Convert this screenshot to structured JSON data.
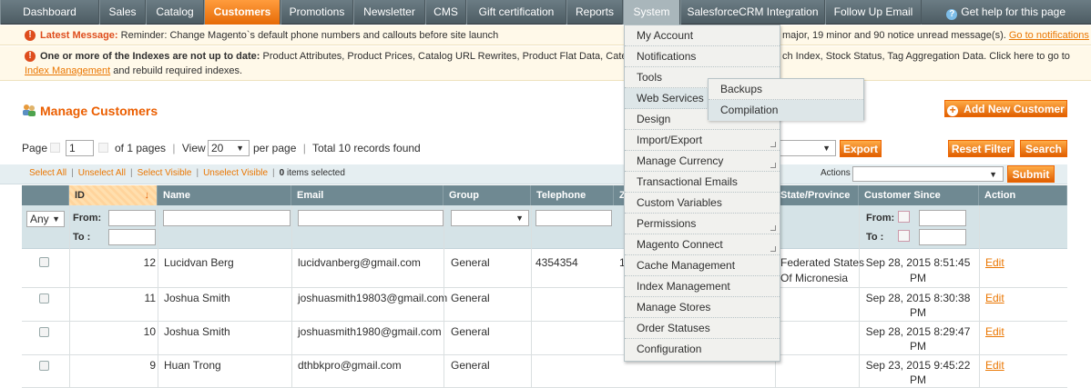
{
  "nav": {
    "items": [
      {
        "label": "Dashboard"
      },
      {
        "label": "Sales"
      },
      {
        "label": "Catalog"
      },
      {
        "label": "Customers"
      },
      {
        "label": "Promotions"
      },
      {
        "label": "Newsletter"
      },
      {
        "label": "CMS"
      },
      {
        "label": "Gift certification"
      },
      {
        "label": "Reports"
      },
      {
        "label": "System"
      },
      {
        "label": "SalesforceCRM Integration"
      },
      {
        "label": "Follow Up Email"
      }
    ],
    "active": "Customers",
    "open": "System",
    "help": "Get help for this page"
  },
  "messages": {
    "latest_label": "Latest Message:",
    "latest_text": "Reminder: Change Magento`s default phone numbers and callouts before site launch",
    "notice_counts_text": "major, 19 minor and 90 notice unread message(s).",
    "notice_link": "Go to notifications",
    "index_label": "One or more of the Indexes are not up to date:",
    "index_text_a": "Product Attributes, Product Prices, Catalog URL Rewrites, Product Flat Data, Category Flat D",
    "index_text_b": "ch Index, Stock Status, Tag Aggregation Data. Click here to go to",
    "index_link": "Index Management",
    "index_text_c": "and rebuild required indexes."
  },
  "header": {
    "title": "Manage Customers",
    "add_button": "Add New Customer"
  },
  "pager": {
    "page_label": "Page",
    "page_value": "1",
    "of_pages": "of 1 pages",
    "view_label": "View",
    "per_page_value": "20",
    "per_page_label": "per page",
    "total": "Total 10 records found",
    "export_button": "Export",
    "reset_button": "Reset Filter",
    "search_button": "Search"
  },
  "massaction": {
    "select_all": "Select All",
    "unselect_all": "Unselect All",
    "select_visible": "Select Visible",
    "unselect_visible": "Unselect Visible",
    "selected_count": "0",
    "selected_label": "items selected",
    "actions_label": "Actions",
    "submit_button": "Submit"
  },
  "grid": {
    "columns": {
      "id": "ID",
      "name": "Name",
      "email": "Email",
      "group": "Group",
      "telephone": "Telephone",
      "zip": "Z",
      "state": "State/Province",
      "since": "Customer Since",
      "action": "Action"
    },
    "filter": {
      "any": "Any",
      "from": "From:",
      "to": "To :"
    },
    "rows": [
      {
        "id": "12",
        "name": "Lucidvan Berg",
        "email": "lucidvanberg@gmail.com",
        "group": "General",
        "telephone": "4354354",
        "zip": "1",
        "state_1": "Federated States",
        "state_2": "Of Micronesia",
        "since_1": "Sep 28, 2015 8:51:45",
        "since_2": "PM",
        "action": "Edit"
      },
      {
        "id": "11",
        "name": "Joshua Smith",
        "email": "joshuasmith19803@gmail.com",
        "group": "General",
        "telephone": "",
        "zip": "",
        "state_1": "",
        "state_2": "",
        "since_1": "Sep 28, 2015 8:30:38",
        "since_2": "PM",
        "action": "Edit"
      },
      {
        "id": "10",
        "name": "Joshua Smith",
        "email": "joshuasmith1980@gmail.com",
        "group": "General",
        "telephone": "",
        "zip": "",
        "state_1": "",
        "state_2": "",
        "since_1": "Sep 28, 2015 8:29:47",
        "since_2": "PM",
        "action": "Edit"
      },
      {
        "id": "9",
        "name": "Huan Trong",
        "email": "dthbkpro@gmail.com",
        "group": "General",
        "telephone": "",
        "zip": "",
        "state_1": "",
        "state_2": "",
        "since_1": "Sep 23, 2015 9:45:22",
        "since_2": "PM",
        "action": "Edit"
      }
    ]
  },
  "system_menu": {
    "items": [
      {
        "label": "My Account"
      },
      {
        "label": "Notifications"
      },
      {
        "label": "Tools"
      },
      {
        "label": "Web Services"
      },
      {
        "label": "Design"
      },
      {
        "label": "Import/Export"
      },
      {
        "label": "Manage Currency"
      },
      {
        "label": "Transactional Emails"
      },
      {
        "label": "Custom Variables"
      },
      {
        "label": "Permissions"
      },
      {
        "label": "Magento Connect"
      },
      {
        "label": "Cache Management"
      },
      {
        "label": "Index Management"
      },
      {
        "label": "Manage Stores"
      },
      {
        "label": "Order Statuses"
      },
      {
        "label": "Configuration"
      }
    ],
    "tools_submenu": [
      {
        "label": "Backups"
      },
      {
        "label": "Compilation"
      }
    ]
  }
}
